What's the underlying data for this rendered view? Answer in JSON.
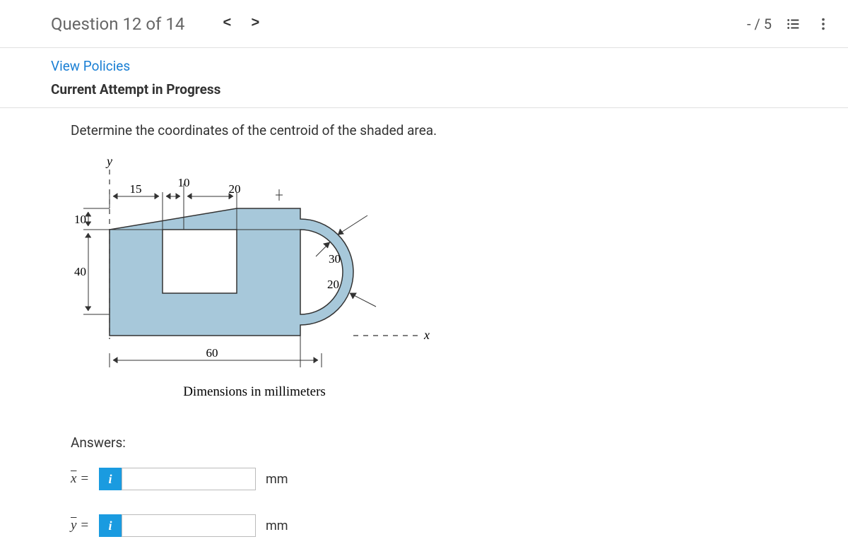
{
  "header": {
    "title": "Question 12 of 14",
    "score": "- / 5"
  },
  "links": {
    "policies": "View Policies"
  },
  "attempt_status": "Current Attempt in Progress",
  "prompt": "Determine the coordinates of the centroid of the shaded area.",
  "figure": {
    "caption": "Dimensions in millimeters",
    "y_label": "y",
    "x_label": "x",
    "dim_15": "15",
    "dim_10_top": "10",
    "dim_20_top": "20",
    "dim_10_left": "10",
    "dim_40": "40",
    "dim_30": "30",
    "dim_20_r": "20",
    "dim_60": "60"
  },
  "answers": {
    "label": "Answers:",
    "x_var": "x̄ =",
    "y_var": "ȳ =",
    "unit": "mm",
    "x_value": "",
    "y_value": ""
  }
}
